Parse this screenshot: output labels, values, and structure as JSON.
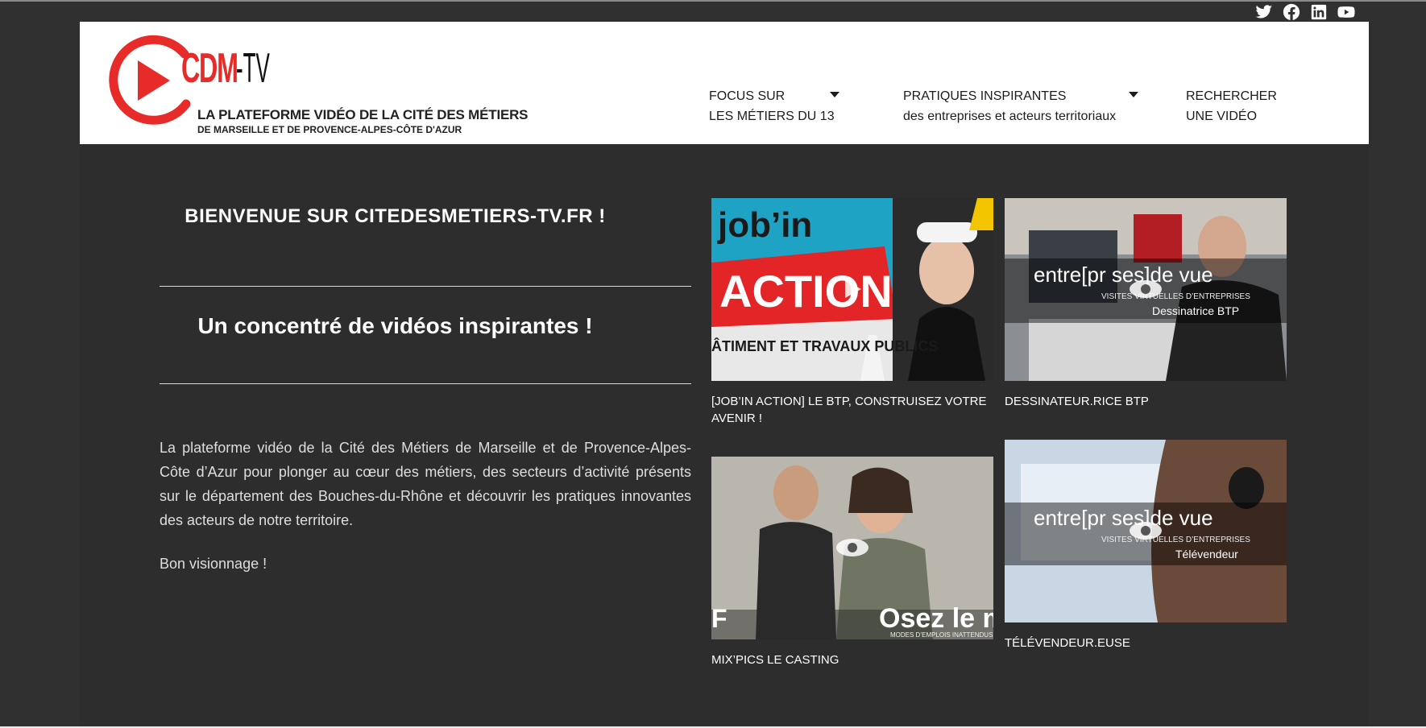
{
  "social": [
    {
      "icon": "twitter-icon"
    },
    {
      "icon": "facebook-icon"
    },
    {
      "icon": "linkedin-icon"
    },
    {
      "icon": "youtube-icon"
    }
  ],
  "logo": {
    "brand": "CDM",
    "suffix": "-TV",
    "tagline_1": "LA PLATEFORME VIDÉO DE LA CITÉ DES MÉTIERS",
    "tagline_2": "DE MARSEILLE ET DE PROVENCE-ALPES-CÔTE D'AZUR"
  },
  "nav": {
    "focus": {
      "line1": "FOCUS SUR",
      "line2": "LES MÉTIERS DU 13"
    },
    "pratiques": {
      "line1": "PRATIQUES INSPIRANTES",
      "line2": "des entreprises et acteurs territoriaux"
    },
    "recherche": {
      "line1": "RECHERCHER",
      "line2": "UNE VIDÉO"
    }
  },
  "main": {
    "welcome": "BIENVENUE SUR CITEDESMETIERS-TV.FR !",
    "subtitle": "Un concentré de vidéos inspirantes !",
    "intro": "La plateforme vidéo de la Cité des Métiers de Marseille et de Provence-Alpes-Côte d’Azur pour plonger au cœur des métiers, des secteurs d’activité présents sur le département des Bouches-du-Rhône et découvrir les pratiques innovantes des acteurs de notre territoire.",
    "closing": "Bon visionnage !"
  },
  "videos": [
    {
      "title": "[JOB’IN ACTION] LE BTP, CONSTRUISEZ VOTRE AVENIR !",
      "overlay_1": "job’in",
      "overlay_2": "ACTION",
      "overlay_3": "ÂTIMENT ET TRAVAUX PUBLICS"
    },
    {
      "title": "DESSINATEUR.RICE BTP",
      "overlay_1": "entre[pr ses]de vue",
      "overlay_2": "VISITES VIRTUELLES D’ENTREPRISES",
      "overlay_3": "Dessinatrice BTP"
    },
    {
      "title": "MIX’PICS LE CASTING",
      "overlay_1": "Osez le mi",
      "overlay_2": "F",
      "overlay_3": "MODES D’EMPLOIS INATTENDUS"
    },
    {
      "title": "TÉLÉVENDEUR.EUSE",
      "overlay_1": "entre[pr ses]de vue",
      "overlay_2": "VISITES VIRTUELLES D’ENTREPRISES",
      "overlay_3": "Télévendeur"
    }
  ],
  "colors": {
    "background": "#2d2d2d",
    "header": "#ffffff",
    "brand_red": "#e62b28"
  }
}
